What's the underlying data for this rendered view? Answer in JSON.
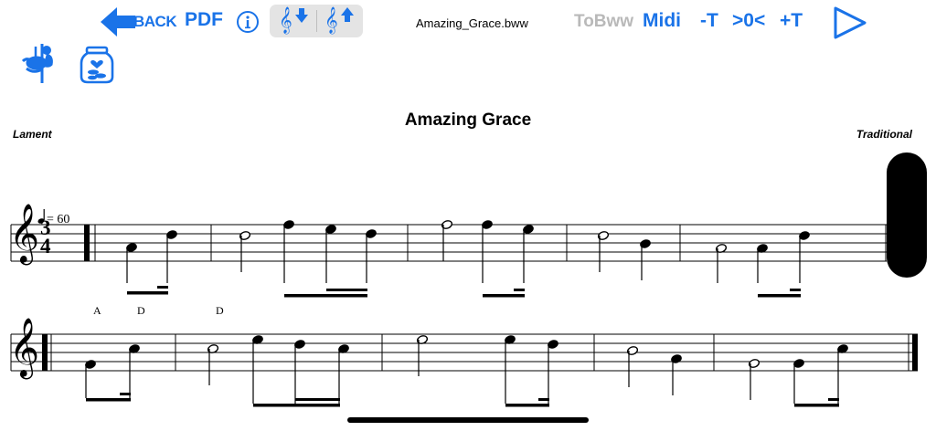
{
  "toolbar": {
    "back_label": "BACK",
    "pdf_label": "PDF",
    "info_icon": "info-circle-icon",
    "clef_down_icon": "treble-clef-down-icon",
    "clef_up_icon": "treble-clef-up-icon",
    "filename": "Amazing_Grace.bww",
    "tobww_label": "ToBww",
    "midi_label": "Midi",
    "minus_t_label": "-T",
    "zero_label": ">0<",
    "plus_t_label": "+T",
    "play_icon": "play-icon",
    "piper_icon": "bagpiper-icon",
    "jar_icon": "tip-jar-icon",
    "accent_color": "#1a73e8",
    "disabled_color": "#b9b9b9"
  },
  "score": {
    "title": "Amazing Grace",
    "style": "Lament",
    "composer": "Traditional",
    "time_sig_top": "3",
    "time_sig_bottom": "4",
    "tempo_text": "= 60",
    "chords": [
      "A",
      "D",
      "D"
    ]
  }
}
